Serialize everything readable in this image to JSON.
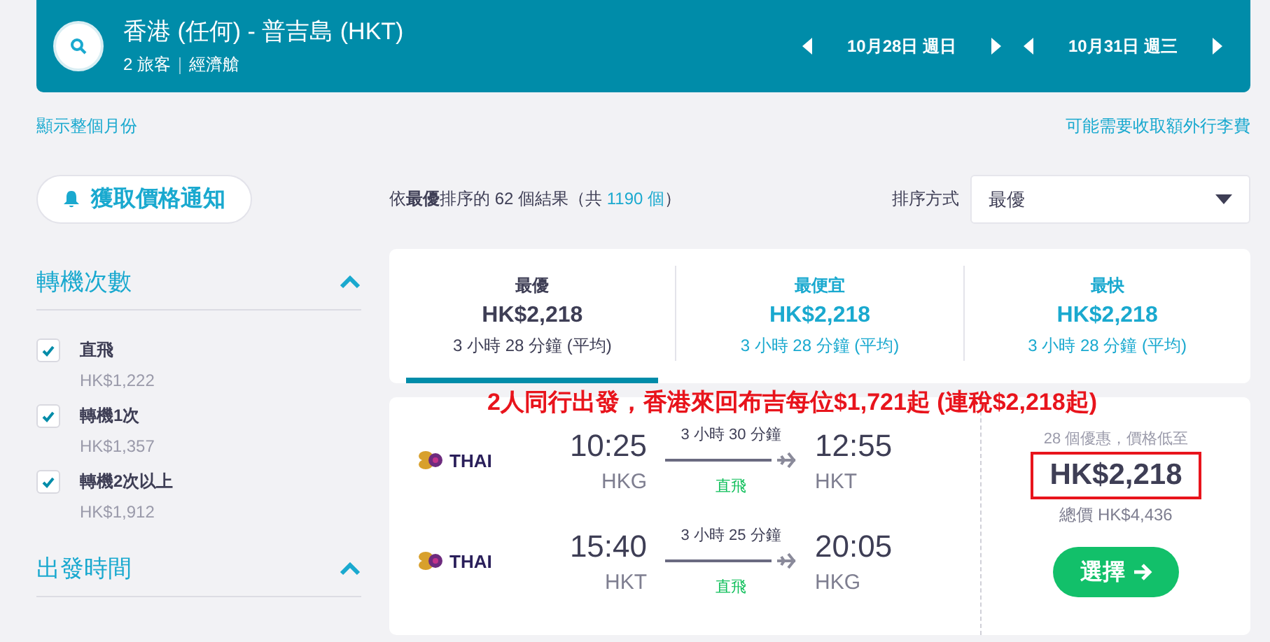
{
  "search": {
    "route": "香港 (任何) - 普吉島 (HKT)",
    "travellers": "2 旅客",
    "cabin": "經濟艙",
    "dates": [
      "10月28日 週日",
      "10月31日 週三"
    ]
  },
  "links": {
    "month": "顯示整個月份",
    "baggage": "可能需要收取額外行李費"
  },
  "alert_button": "獲取價格通知",
  "filters": [
    {
      "title": "轉機次數",
      "expanded": true,
      "options": [
        {
          "label": "直飛",
          "price": "HK$1,222",
          "checked": true
        },
        {
          "label": "轉機1次",
          "price": "HK$1,357",
          "checked": true
        },
        {
          "label": "轉機2次以上",
          "price": "HK$1,912",
          "checked": true
        }
      ]
    },
    {
      "title": "出發時間",
      "expanded": true
    }
  ],
  "results": {
    "text": "依**最優**排序的 62 個結果（共",
    "link": "1190 個",
    "suffix": "）"
  },
  "sort": {
    "label": "排序方式",
    "value": "最優"
  },
  "tabs": [
    {
      "label": "最優",
      "price": "HK$2,218",
      "duration": "3 小時 28 分鐘 (平均)",
      "selected": true
    },
    {
      "label": "最便宜",
      "price": "HK$2,218",
      "duration": "3 小時 28 分鐘 (平均)",
      "selected": false
    },
    {
      "label": "最快",
      "price": "HK$2,218",
      "duration": "3 小時 28 分鐘 (平均)",
      "selected": false
    }
  ],
  "annotation": "2人同行出發，香港來回布吉每位$1,721起 (連稅$2,218起)",
  "flight": {
    "legs": [
      {
        "airline": "THAI",
        "depart": "10:25",
        "from": "HKG",
        "duration": "3 小時 30 分鐘",
        "stops": "直飛",
        "arrive": "12:55",
        "to": "HKT"
      },
      {
        "airline": "THAI",
        "depart": "15:40",
        "from": "HKT",
        "duration": "3 小時 25 分鐘",
        "stops": "直飛",
        "arrive": "20:05",
        "to": "HKG"
      }
    ],
    "deals": "28 個優惠，價格低至",
    "price": "HK$2,218",
    "total": "總價 HK$4,436",
    "select": "選擇"
  }
}
